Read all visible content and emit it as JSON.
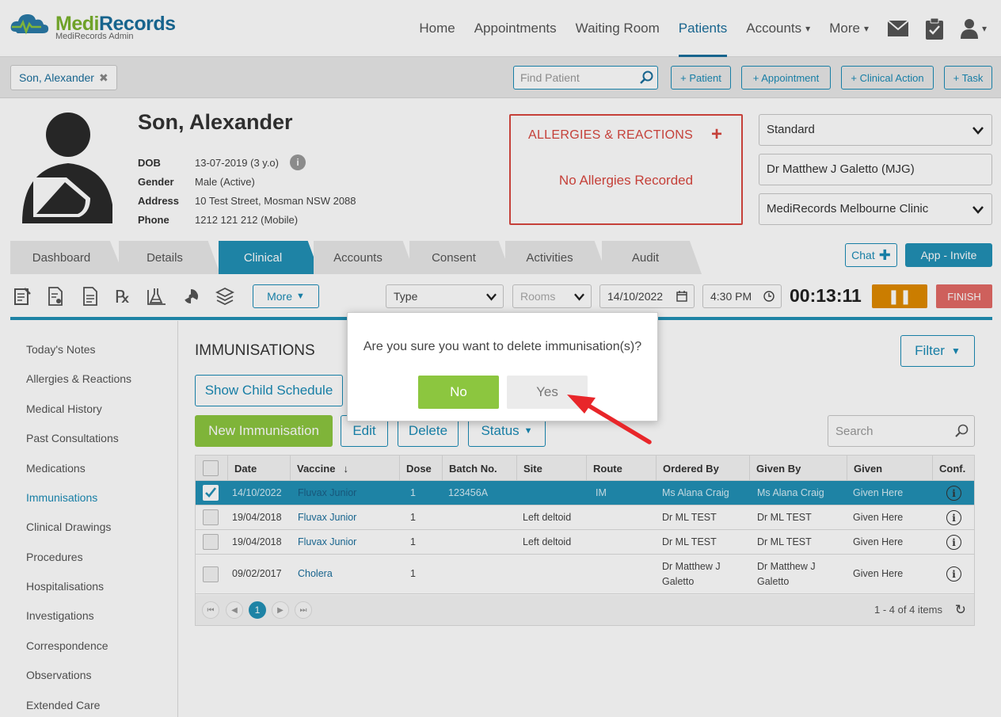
{
  "brand": {
    "name_part1": "Medi",
    "name_part2": "Records",
    "subtitle": "MediRecords Admin"
  },
  "nav": {
    "items": [
      {
        "label": "Home"
      },
      {
        "label": "Appointments"
      },
      {
        "label": "Waiting Room"
      },
      {
        "label": "Patients",
        "active": true
      },
      {
        "label": "Accounts",
        "dropdown": true
      },
      {
        "label": "More",
        "dropdown": true
      }
    ],
    "icons": [
      "mail-icon",
      "clipboard-icon",
      "user-icon"
    ]
  },
  "strip": {
    "patient_tab": "Son, Alexander",
    "find_placeholder": "Find Patient",
    "actions": [
      "+ Patient",
      "+ Appointment",
      "+ Clinical Action",
      "+ Task"
    ]
  },
  "patient": {
    "name": "Son, Alexander",
    "dob_label": "DOB",
    "dob": "13-07-2019 (3 y.o)",
    "gender_label": "Gender",
    "gender": "Male (Active)",
    "address_label": "Address",
    "address": "10 Test Street, Mosman NSW 2088",
    "phone_label": "Phone",
    "phone": "1212 121 212 (Mobile)"
  },
  "allergies": {
    "title": "ALLERGIES & REACTIONS",
    "add": "+",
    "status": "No Allergies Recorded"
  },
  "right_selects": {
    "type": "Standard",
    "doctor": "Dr Matthew J Galetto (MJG)",
    "clinic": "MediRecords Melbourne Clinic"
  },
  "tabs": [
    "Dashboard",
    "Details",
    "Clinical",
    "Accounts",
    "Consent",
    "Activities",
    "Audit"
  ],
  "tabs_right": {
    "chat": "Chat",
    "invite": "App - Invite"
  },
  "toolbar": {
    "more": "More",
    "type": "Type",
    "rooms": "Rooms",
    "date": "14/10/2022",
    "time": "4:30 PM",
    "timer": "00:13:11",
    "finish": "FINISH"
  },
  "sidebar": {
    "items": [
      {
        "label": "Today's Notes"
      },
      {
        "label": "Allergies & Reactions"
      },
      {
        "label": "Medical History"
      },
      {
        "label": "Past Consultations"
      },
      {
        "label": "Medications"
      },
      {
        "label": "Immunisations",
        "active": true
      },
      {
        "label": "Clinical Drawings"
      },
      {
        "label": "Procedures"
      },
      {
        "label": "Hospitalisations"
      },
      {
        "label": "Investigations"
      },
      {
        "label": "Correspondence"
      },
      {
        "label": "Observations"
      },
      {
        "label": "Extended Care"
      }
    ]
  },
  "main": {
    "title": "IMMUNISATIONS",
    "filter": "Filter",
    "show_child_schedule": "Show Child Schedule",
    "new_immunisation": "New Immunisation",
    "edit": "Edit",
    "delete": "Delete",
    "status": "Status",
    "search_placeholder": "Search"
  },
  "table": {
    "columns": [
      "Date",
      "Vaccine",
      "Dose",
      "Batch No.",
      "Site",
      "Route",
      "Ordered By",
      "Given By",
      "Given",
      "Conf."
    ],
    "rows": [
      {
        "selected": true,
        "date": "14/10/2022",
        "vaccine": "Fluvax Junior",
        "dose": "1",
        "batch": "123456A",
        "site": "",
        "route": "IM",
        "ordered_by": "Ms Alana Craig",
        "given_by": "Ms Alana Craig",
        "given": "Given Here"
      },
      {
        "selected": false,
        "date": "19/04/2018",
        "vaccine": "Fluvax Junior",
        "dose": "1",
        "batch": "",
        "site": "Left deltoid",
        "route": "",
        "ordered_by": "Dr ML TEST",
        "given_by": "Dr ML TEST",
        "given": "Given Here"
      },
      {
        "selected": false,
        "date": "19/04/2018",
        "vaccine": "Fluvax Junior",
        "dose": "1",
        "batch": "",
        "site": "Left deltoid",
        "route": "",
        "ordered_by": "Dr ML TEST",
        "given_by": "Dr ML TEST",
        "given": "Given Here"
      },
      {
        "selected": false,
        "date": "09/02/2017",
        "vaccine": "Cholera",
        "dose": "1",
        "batch": "",
        "site": "",
        "route": "",
        "ordered_by": "Dr Matthew J Galetto",
        "given_by": "Dr Matthew J Galetto",
        "given": "Given Here"
      }
    ],
    "page": "1",
    "items_text": "1 - 4 of 4 items"
  },
  "dialog": {
    "question": "Are you sure you want to delete immunisation(s)?",
    "no": "No",
    "yes": "Yes"
  },
  "colors": {
    "accent": "#2291b6",
    "green": "#8cc63f",
    "danger": "#d9473f",
    "orange": "#e08a00"
  }
}
